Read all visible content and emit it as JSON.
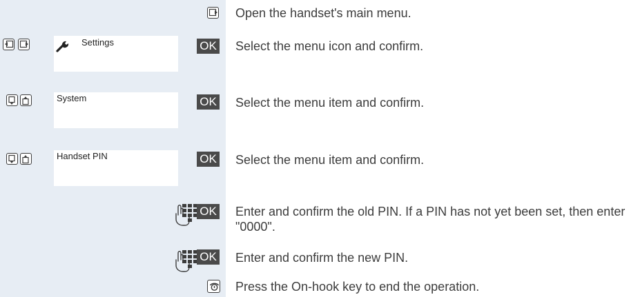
{
  "steps": [
    {
      "description": "Open the handset's main menu."
    },
    {
      "menu_label": "Settings",
      "ok_label": "OK",
      "description": "Select the menu icon and confirm."
    },
    {
      "menu_label": "System",
      "ok_label": "OK",
      "description": "Select the menu item and confirm."
    },
    {
      "menu_label": "Handset PIN",
      "ok_label": "OK",
      "description": "Select the menu item and confirm."
    },
    {
      "ok_label": "OK",
      "description": "Enter and confirm the old PIN. If a PIN has not yet been set, then enter \"0000\"."
    },
    {
      "ok_label": "OK",
      "description": "Enter and confirm the new PIN."
    },
    {
      "description": "Press the On-hook key to end the operation."
    }
  ],
  "icons": {
    "step1": [
      "control-key-right-icon"
    ],
    "step2": [
      "control-key-left-icon",
      "control-key-right-icon",
      "wrench-icon"
    ],
    "step3": [
      "control-key-down-icon",
      "control-key-up-icon"
    ],
    "step4": [
      "control-key-down-icon",
      "control-key-up-icon"
    ],
    "step5": [
      "keypad-icon"
    ],
    "step6": [
      "keypad-icon"
    ],
    "step7": [
      "on-hook-key-icon"
    ]
  },
  "colors": {
    "left_panel": "#e7edf4",
    "ok_badge": "#4a4a4a",
    "text": "#3c3c3c"
  }
}
